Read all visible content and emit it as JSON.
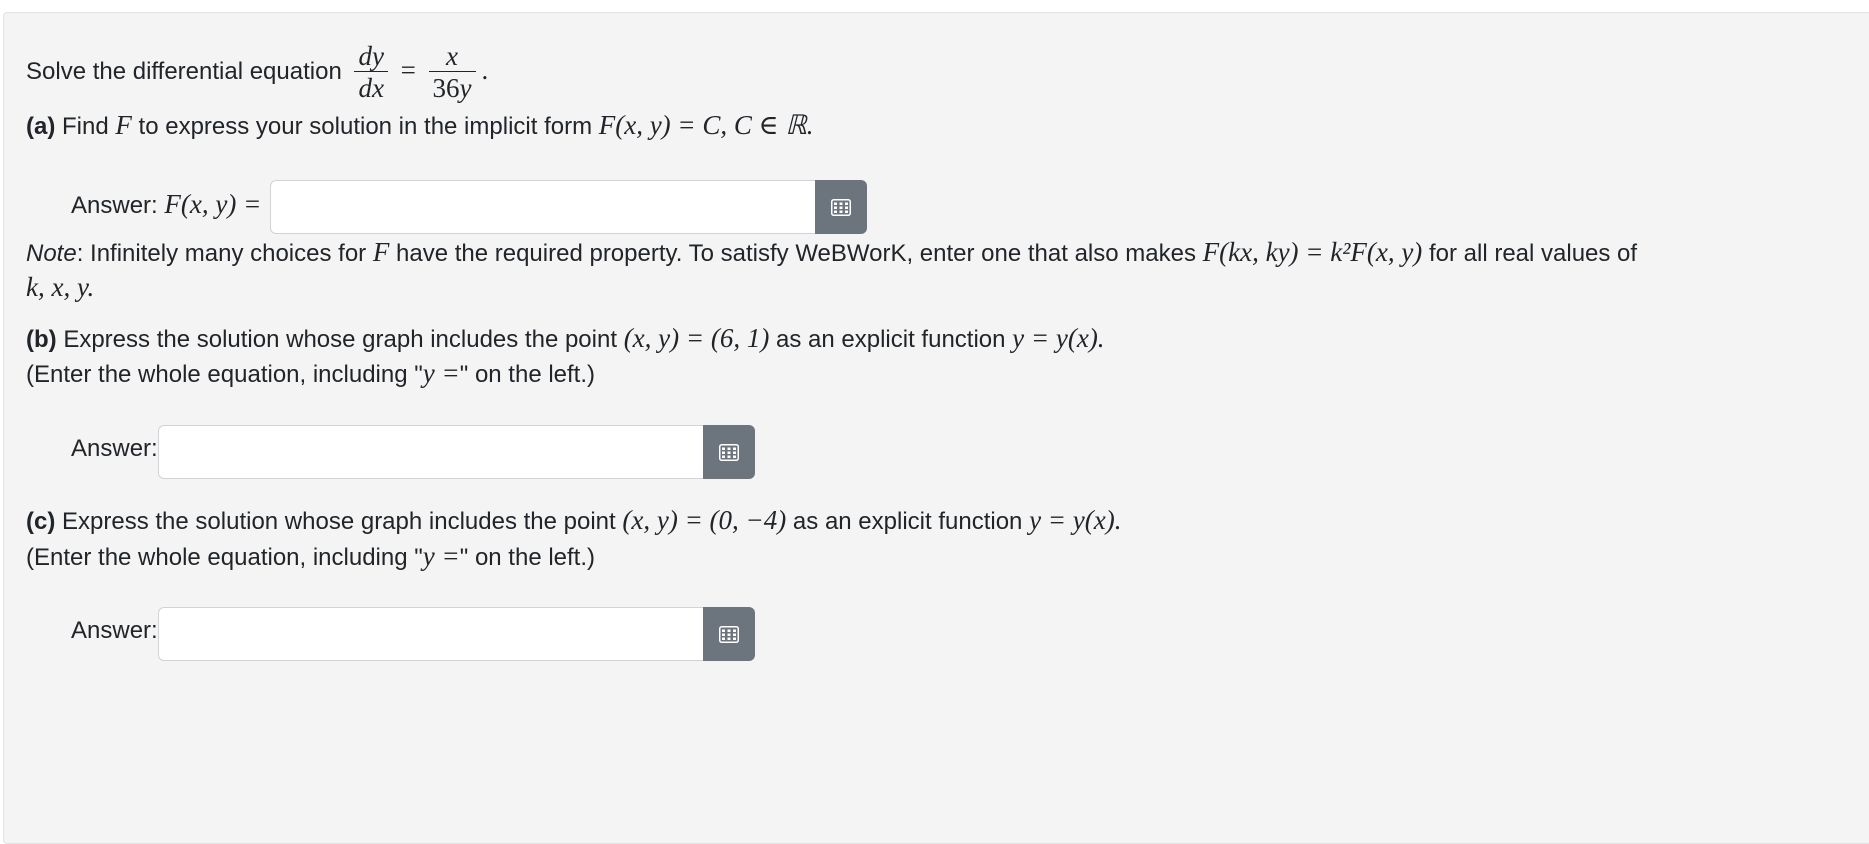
{
  "intro": {
    "text": "Solve the differential equation",
    "frac_left_num": "dy",
    "frac_left_den": "dx",
    "equals": "=",
    "frac_right_num": "x",
    "frac_right_den_num": "36",
    "frac_right_den_var": "y",
    "end": "."
  },
  "part_a": {
    "label": "(a)",
    "text_1": "Find",
    "var_F": "F",
    "text_2": "to express your solution in the implicit form",
    "math": "F(x, y) = C, C ∈ ℝ.",
    "answer_label": "Answer:",
    "answer_math": "F(x, y) =",
    "answer_value": "",
    "note_label": "Note",
    "note_text_1": ": Infinitely many choices for",
    "note_var": "F",
    "note_text_2": "have the required property. To satisfy WeBWorK, enter one that also makes",
    "note_math": "F(kx, ky) = k²F(x, y)",
    "note_text_3": "for all real values of",
    "note_line2": "k, x, y."
  },
  "part_b": {
    "label": "(b)",
    "text_1": "Express the solution whose graph includes the point",
    "math_point": "(x, y) = (6, 1)",
    "text_2": "as an explicit function",
    "math_func": "y = y(x).",
    "hint_1": "(Enter the whole equation, including \"",
    "hint_math": "y =",
    "hint_2": "\" on the left.)",
    "answer_label": "Answer:",
    "answer_value": ""
  },
  "part_c": {
    "label": "(c)",
    "text_1": "Express the solution whose graph includes the point",
    "math_point": "(x, y) = (0, −4)",
    "text_2": "as an explicit function",
    "math_func": "y = y(x).",
    "hint_1": "(Enter the whole equation, including \"",
    "hint_math": "y =",
    "hint_2": "\" on the left.)",
    "answer_label": "Answer:",
    "answer_value": ""
  },
  "colors": {
    "panel_bg": "#f4f4f4",
    "button_bg": "#6c757d",
    "text": "#212529"
  },
  "icons": {
    "equation_editor": "grid-keyboard-icon"
  }
}
